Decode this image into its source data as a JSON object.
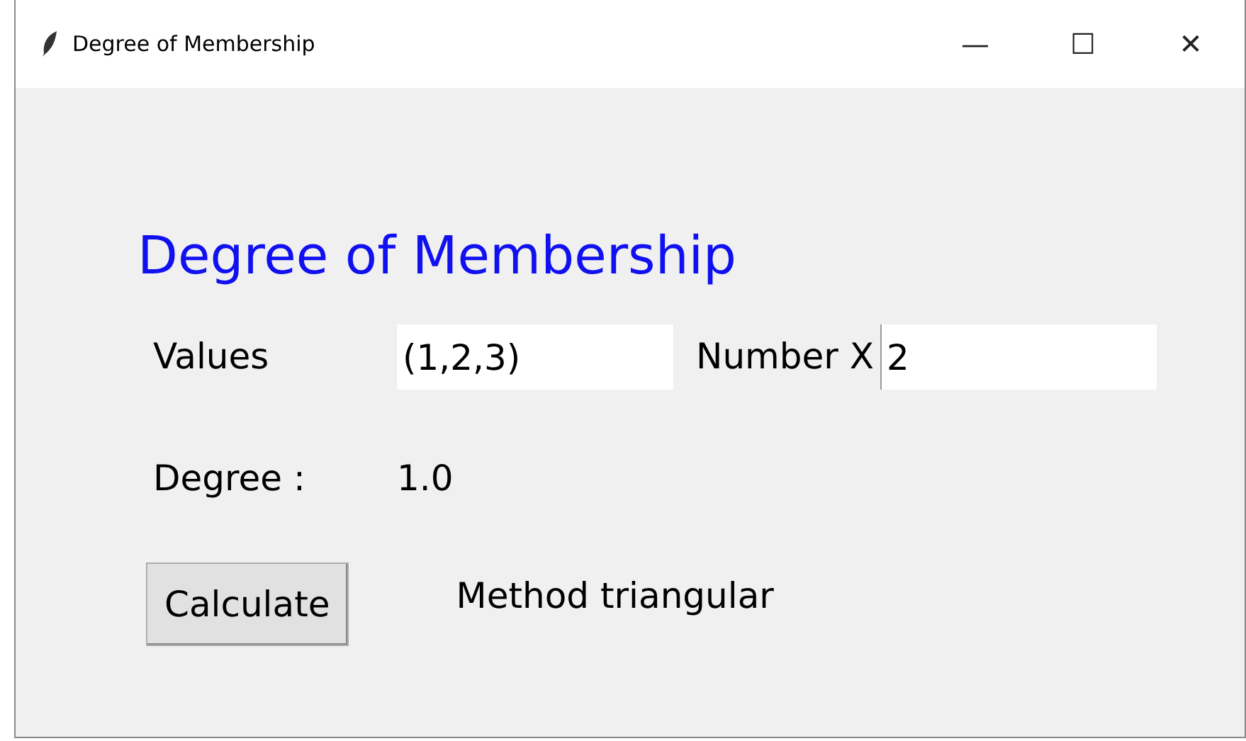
{
  "window": {
    "title": "Degree of Membership",
    "controls": [
      "—",
      "☐",
      "✕"
    ]
  },
  "heading": "Degree of Membership",
  "values": {
    "label": "Values",
    "value": "(1,2,3)"
  },
  "number": {
    "label": "Number X",
    "value": "2",
    "focused": true
  },
  "degree": {
    "label": "Degree :",
    "value": "1.0"
  },
  "button": "Calculate",
  "method": "Method triangular"
}
